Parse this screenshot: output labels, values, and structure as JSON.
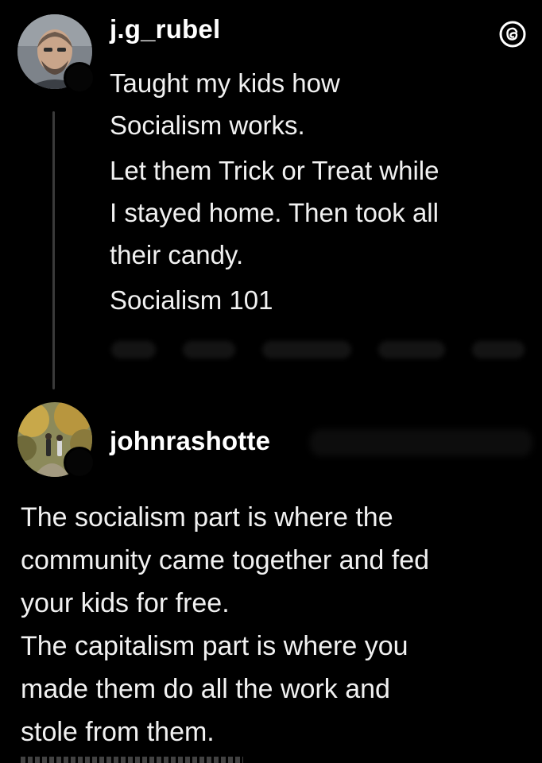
{
  "posts": [
    {
      "username": "j.g_rubel",
      "paragraphs": [
        "Taught my kids how",
        "Socialism works.",
        "Let them Trick or Treat while",
        "I stayed home. Then took all",
        "their candy.",
        "Socialism 101"
      ]
    },
    {
      "username": "johnrashotte",
      "paragraphs": [
        "The socialism part is where the",
        "community came together and fed",
        "your kids for free.",
        "The capitalism part is where you",
        "made them do all the work and",
        "stole from them."
      ]
    }
  ],
  "icons": {
    "app_logo": "threads-logo-icon"
  },
  "colors": {
    "background": "#000000",
    "text": "#f1f1f1",
    "thread_line": "#3a3a3a"
  }
}
